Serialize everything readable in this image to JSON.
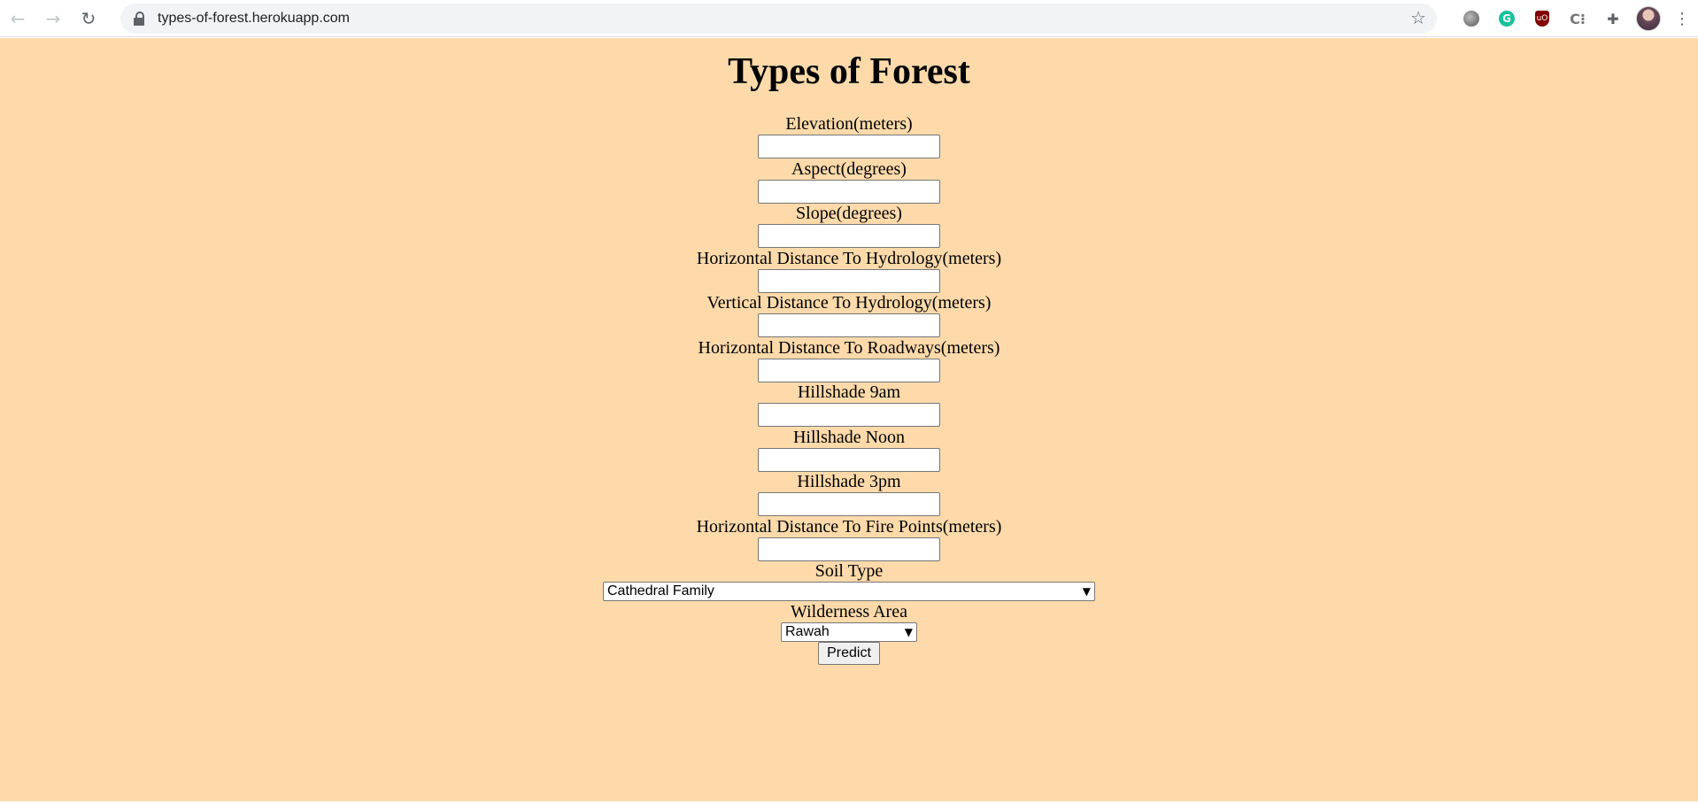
{
  "browser": {
    "url": "types-of-forest.herokuapp.com",
    "back_icon": "arrow-left-icon",
    "forward_icon": "arrow-right-icon",
    "reload_icon": "reload-icon",
    "star_icon": "star-icon"
  },
  "page": {
    "title": "Types of Forest",
    "background_color": "#fedaab",
    "fields": [
      {
        "label": "Elevation(meters)",
        "value": ""
      },
      {
        "label": "Aspect(degrees)",
        "value": ""
      },
      {
        "label": "Slope(degrees)",
        "value": ""
      },
      {
        "label": "Horizontal Distance To Hydrology(meters)",
        "value": ""
      },
      {
        "label": "Vertical Distance To Hydrology(meters)",
        "value": ""
      },
      {
        "label": "Horizontal Distance To Roadways(meters)",
        "value": ""
      },
      {
        "label": "Hillshade 9am",
        "value": ""
      },
      {
        "label": "Hillshade Noon",
        "value": ""
      },
      {
        "label": "Hillshade 3pm",
        "value": ""
      },
      {
        "label": "Horizontal Distance To Fire Points(meters)",
        "value": ""
      }
    ],
    "soil_type": {
      "label": "Soil Type",
      "selected": "Cathedral Family"
    },
    "wilderness_area": {
      "label": "Wilderness Area",
      "selected": "Rawah"
    },
    "predict_label": "Predict"
  }
}
